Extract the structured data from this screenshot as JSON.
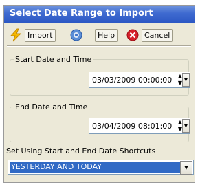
{
  "window": {
    "title": "Select Date Range to Import"
  },
  "toolbar": {
    "import_label": "Import",
    "help_label": "Help",
    "cancel_label": "Cancel"
  },
  "start": {
    "group_label": "Start Date and Time",
    "value": "03/03/2009 00:00:00"
  },
  "end": {
    "group_label": "End Date and Time",
    "value": "03/04/2009 08:01:00"
  },
  "shortcuts": {
    "group_label": "Set Using Start and End Date Shortcuts",
    "selected": "YESTERDAY AND TODAY"
  },
  "colors": {
    "title_bar": "#3f6ad0",
    "dialog_bg": "#ece9d8",
    "selection": "#316ac5"
  },
  "icons": {
    "import": "lightning-icon",
    "help": "help-icon",
    "cancel": "cancel-icon"
  }
}
